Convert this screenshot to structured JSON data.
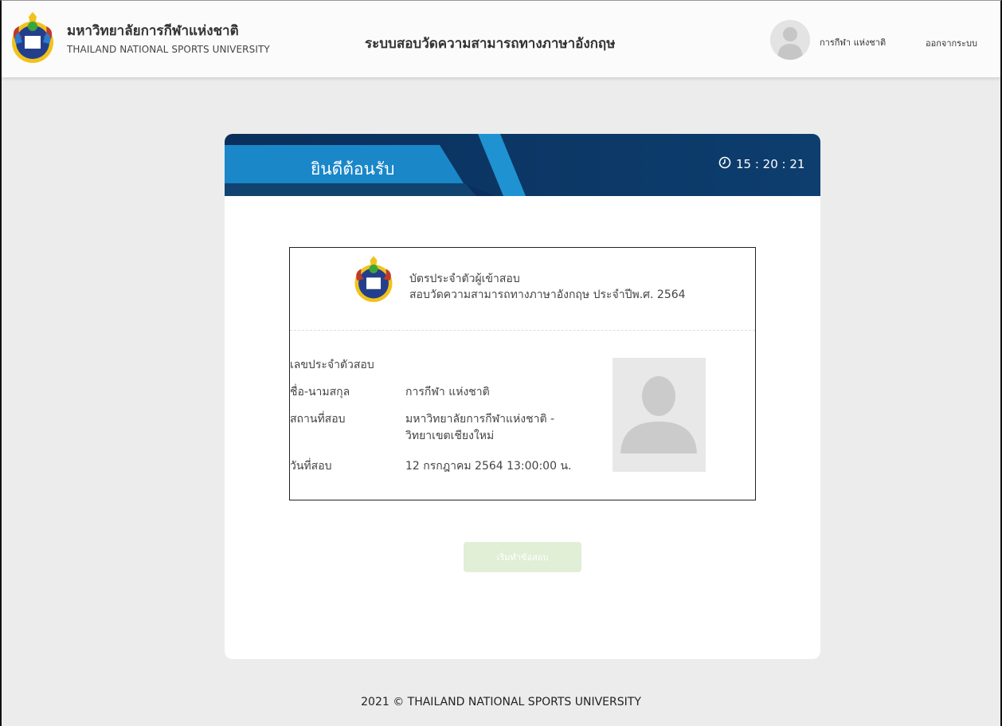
{
  "header": {
    "university_name_th": "มหาวิทยาลัยการกีฬาแห่งชาติ",
    "university_name_en": "THAILAND NATIONAL SPORTS UNIVERSITY",
    "system_title": "ระบบสอบวัดความสามารถทางภาษาอังกฤษ",
    "user_name": "การกีฬา แห่งชาติ",
    "logout_label": "ออกจากระบบ"
  },
  "banner": {
    "welcome_text": "ยินดีต้อนรับ",
    "timer": "15 : 20 : 21"
  },
  "id_card": {
    "title": "บัตรประจำตัวผู้เข้าสอบ",
    "subtitle": "สอบวัดความสามารถทางภาษาอังกฤษ ประจำปีพ.ศ. 2564",
    "rows": [
      {
        "label": "เลขประจำตัวสอบ",
        "value": ""
      },
      {
        "label": "ชื่อ-นามสกุล",
        "value": "การกีฬา แห่งชาติ"
      },
      {
        "label": "สถานที่สอบ",
        "value": "มหาวิทยาลัยการกีฬาแห่งชาติ -",
        "value2": "วิทยาเขตเชียงใหม่"
      },
      {
        "label": "วันที่สอบ",
        "value": "12 กรกฎาคม 2564 13:00:00 น."
      }
    ]
  },
  "start_button_label": "เริ่มทำข้อสอบ",
  "footer_text": "2021 © THAILAND NATIONAL SPORTS UNIVERSITY",
  "colors": {
    "banner_dark": "#0b3a6b",
    "banner_light": "#1f93d2",
    "button_disabled": "#e0efd6"
  }
}
